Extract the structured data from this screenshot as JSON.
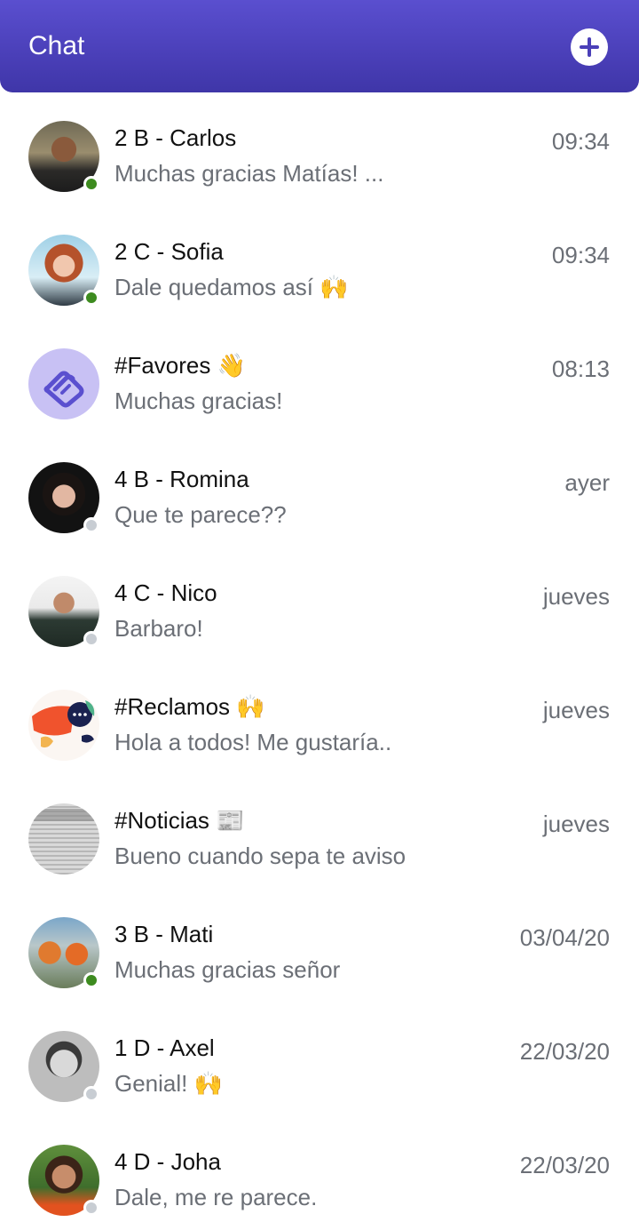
{
  "header": {
    "title": "Chat",
    "add_icon": "plus-circle-icon"
  },
  "chats": [
    {
      "name": "2 B - Carlos",
      "preview": "Muchas gracias Matías! ...",
      "time": "09:34",
      "status": "online"
    },
    {
      "name": "2 C - Sofia",
      "preview": "Dale quedamos así 🙌",
      "time": "09:34",
      "status": "online"
    },
    {
      "name": "#Favores 👋",
      "preview": "Muchas gracias!",
      "time": "08:13",
      "status": "none"
    },
    {
      "name": "4 B - Romina",
      "preview": "Que te parece??",
      "time": "ayer",
      "status": "offline"
    },
    {
      "name": "4 C - Nico",
      "preview": "Barbaro!",
      "time": "jueves",
      "status": "offline"
    },
    {
      "name": "#Reclamos 🙌",
      "preview": "Hola a todos! Me gustaría..",
      "time": "jueves",
      "status": "none"
    },
    {
      "name": "#Noticias 📰",
      "preview": "Bueno cuando sepa te aviso",
      "time": "jueves",
      "status": "none"
    },
    {
      "name": "3 B - Mati",
      "preview": "Muchas gracias señor",
      "time": "03/04/20",
      "status": "online"
    },
    {
      "name": "1 D - Axel",
      "preview": "Genial! 🙌",
      "time": "22/03/20",
      "status": "offline"
    },
    {
      "name": "4 D - Joha",
      "preview": "Dale, me re parece.",
      "time": "22/03/20",
      "status": "offline"
    }
  ],
  "colors": {
    "header": "#4a3fb8",
    "online": "#3d8b1f",
    "offline": "#c8cdd3",
    "preview_text": "#6b6f76"
  }
}
